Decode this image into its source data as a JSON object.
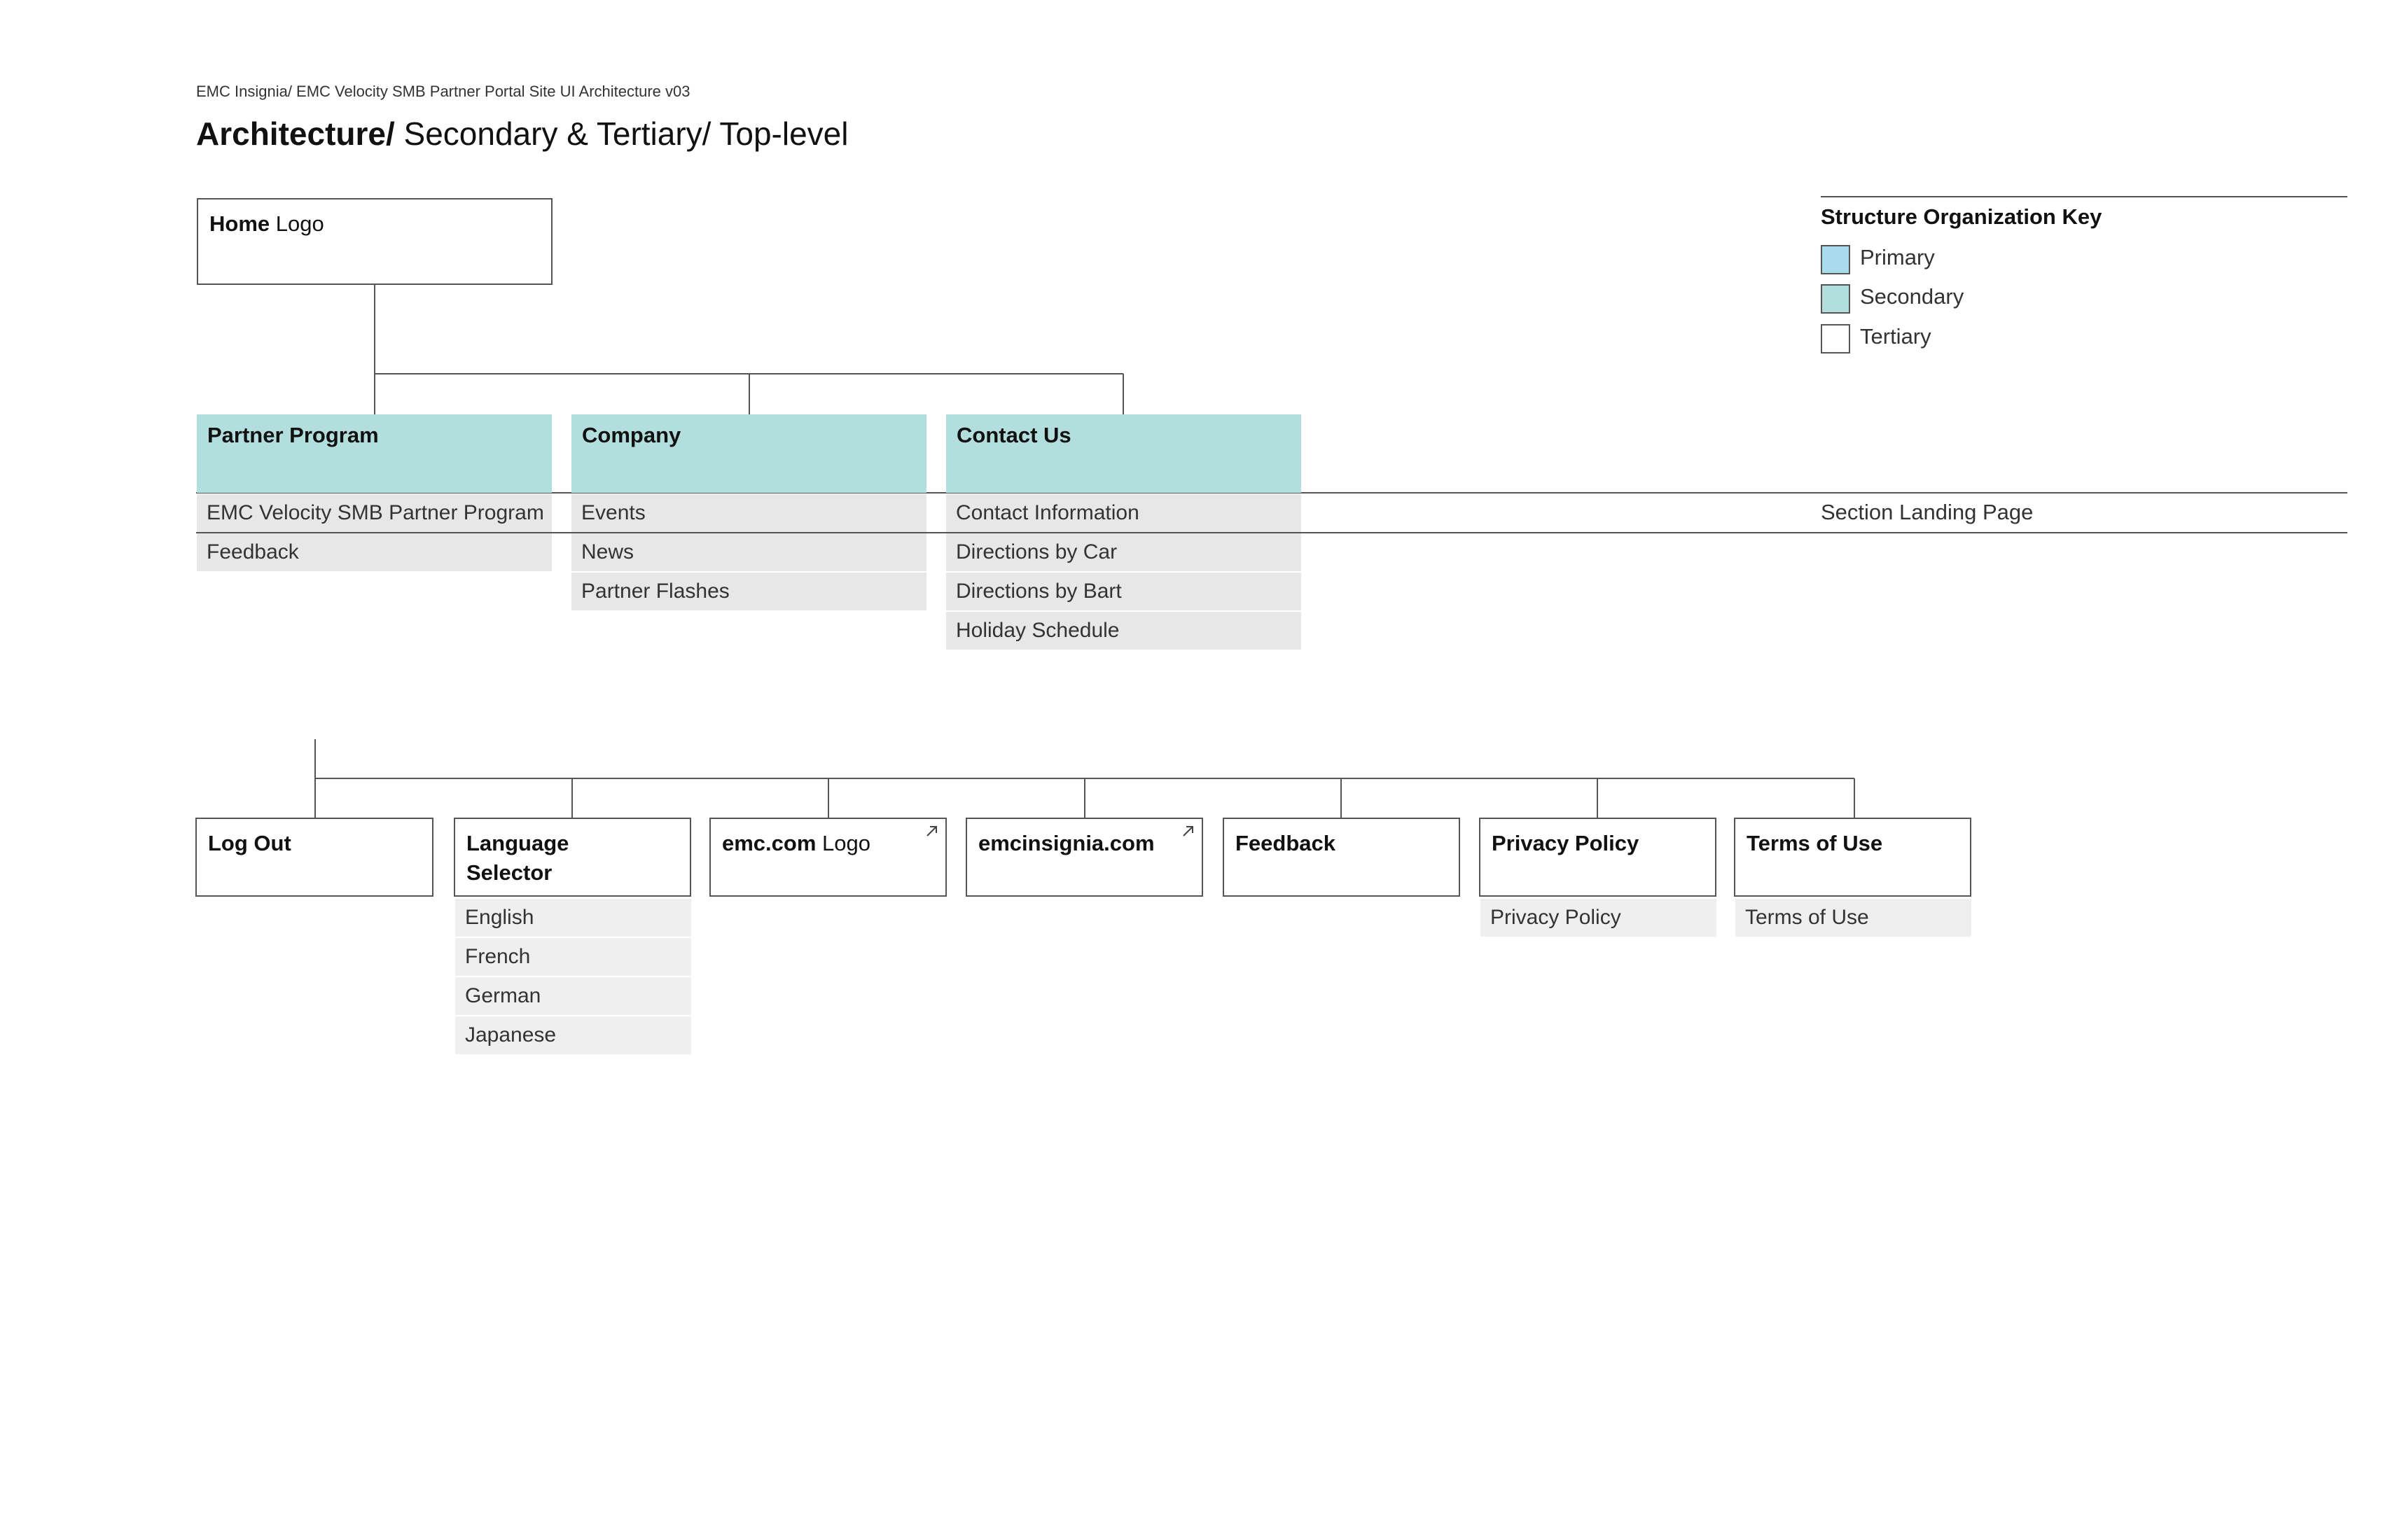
{
  "header": {
    "breadcrumb": "EMC Insignia/ EMC Velocity SMB Partner Portal Site UI Architecture v03",
    "title_bold": "Architecture/",
    "title_rest": " Secondary & Tertiary/ Top-level"
  },
  "home": {
    "bold": "Home",
    "light": " Logo"
  },
  "sections": [
    {
      "title": "Partner Program",
      "items": [
        "EMC Velocity SMB Partner Program",
        "Feedback"
      ]
    },
    {
      "title": "Company",
      "items": [
        "Events",
        "News",
        "Partner Flashes"
      ]
    },
    {
      "title": "Contact Us",
      "items": [
        "Contact Information",
        "Directions by Car",
        "Directions by Bart",
        "Holiday Schedule"
      ]
    }
  ],
  "utility": [
    {
      "bold": "Log Out",
      "light": "",
      "external": false,
      "items": []
    },
    {
      "bold": "Language Selector",
      "light": "",
      "external": false,
      "items": [
        "English",
        "French",
        "German",
        "Japanese"
      ]
    },
    {
      "bold": "emc.com",
      "light": " Logo",
      "external": true,
      "items": []
    },
    {
      "bold": "emcinsignia.com",
      "light": "",
      "external": true,
      "items": []
    },
    {
      "bold": "Feedback",
      "light": "",
      "external": false,
      "items": []
    },
    {
      "bold": "Privacy Policy",
      "light": "",
      "external": false,
      "items": [
        "Privacy Policy"
      ]
    },
    {
      "bold": "Terms of Use",
      "light": "",
      "external": false,
      "items": [
        "Terms of Use"
      ]
    }
  ],
  "key": {
    "title": "Structure Organization Key",
    "entries": [
      {
        "label": "Primary",
        "color": "#a9daee"
      },
      {
        "label": "Secondary",
        "color": "#b2dfdd"
      },
      {
        "label": "Tertiary",
        "color": "#ffffff"
      }
    ]
  },
  "landing_label": "Section Landing Page",
  "colors": {
    "secondary": "#b2dfdd",
    "item": "#e6e7e6",
    "line": "#555555"
  }
}
